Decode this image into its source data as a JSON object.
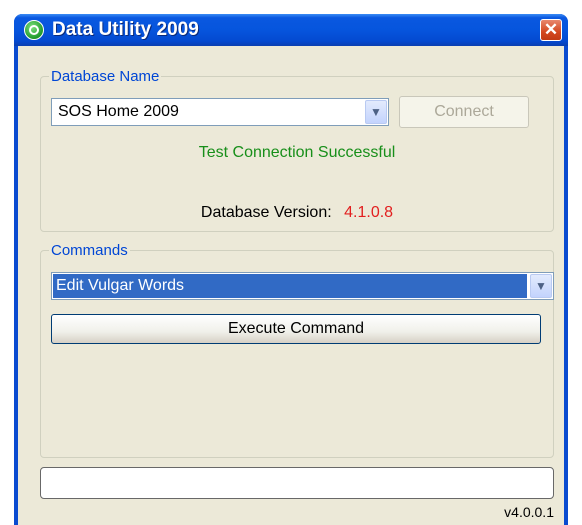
{
  "window": {
    "title": "Data Utility 2009",
    "close_glyph": "✕"
  },
  "database": {
    "group_label": "Database Name",
    "selected": "SOS Home 2009",
    "connect_label": "Connect",
    "connect_enabled": false,
    "status": "Test Connection Successful",
    "version_label": "Database Version:",
    "version_value": "4.1.0.8"
  },
  "commands": {
    "group_label": "Commands",
    "selected": "Edit Vulgar Words",
    "execute_label": "Execute Command"
  },
  "footer": {
    "app_version": "v4.0.0.1"
  },
  "icons": {
    "app": "app-logo-icon",
    "dropdown": "chevron-down-icon",
    "close": "close-icon"
  },
  "colors": {
    "status": "#188f1a",
    "version_value": "#e21f1f",
    "group_label": "#0046d5",
    "selection": "#316ac5"
  }
}
